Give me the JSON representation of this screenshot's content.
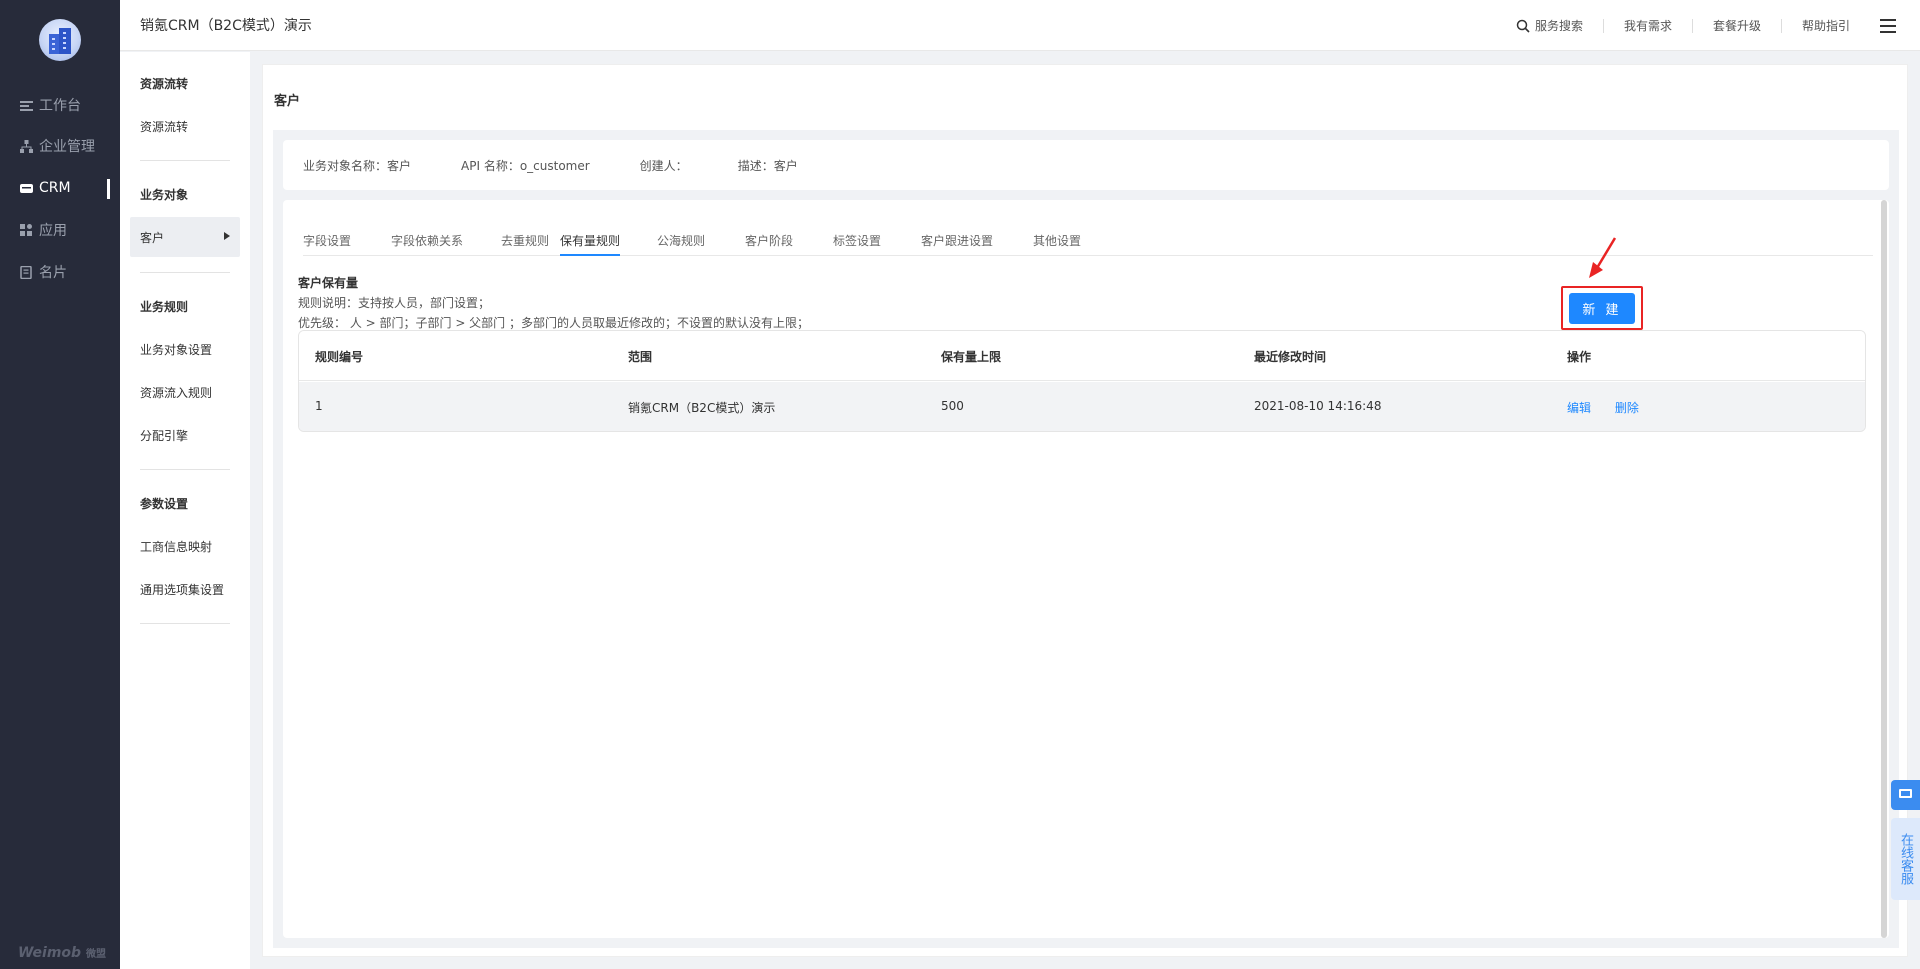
{
  "app": {
    "title": "销氪CRM（B2C模式）演示"
  },
  "leftnav": {
    "items": [
      {
        "label": "工作台",
        "icon": "list-icon",
        "active": false
      },
      {
        "label": "企业管理",
        "icon": "org-chart-icon",
        "active": false
      },
      {
        "label": "CRM",
        "icon": "crm-card-icon",
        "active": true
      },
      {
        "label": "应用",
        "icon": "apps-grid-icon",
        "active": false
      },
      {
        "label": "名片",
        "icon": "business-card-icon",
        "active": false
      }
    ],
    "brand": "Weimob",
    "brand_sub": "微盟"
  },
  "topbar": {
    "search_label": "服务搜索",
    "requirements_label": "我有需求",
    "upgrade_label": "套餐升级",
    "help_label": "帮助指引"
  },
  "sidebar": {
    "g1_title": "资源流转",
    "g1_item1": "资源流转",
    "g2_title": "业务对象",
    "g2_item1": "客户",
    "g3_title": "业务规则",
    "g3_item1": "业务对象设置",
    "g3_item2": "资源流入规则",
    "g3_item3": "分配引擎",
    "g4_title": "参数设置",
    "g4_item1": "工商信息映射",
    "g4_item2": "通用选项集设置"
  },
  "page": {
    "title": "客户",
    "info": {
      "object_name": "业务对象名称：客户",
      "api_name": "API 名称：o_customer",
      "creator": "创建人：",
      "description": "描述：客户"
    },
    "tabs": [
      "字段设置",
      "字段依赖关系",
      "去重规则",
      "保有量规则",
      "公海规则",
      "客户阶段",
      "标签设置",
      "客户跟进设置",
      "其他设置"
    ],
    "active_tab": "保有量规则",
    "rule": {
      "heading": "客户保有量",
      "line1": "规则说明：支持按人员，部门设置；",
      "line2": "优先级： 人 > 部门；子部门 > 父部门 ；多部门的人员取最近修改的；不设置的默认没有上限；"
    },
    "new_button": "新 建",
    "table": {
      "columns": [
        "规则编号",
        "范围",
        "保有量上限",
        "最近修改时间",
        "操作"
      ],
      "rows": [
        {
          "id": "1",
          "scope": "销氪CRM（B2C模式）演示",
          "limit": "500",
          "modified": "2021-08-10 14:16:48",
          "edit": "编辑",
          "delete": "删除"
        }
      ]
    }
  },
  "float": {
    "online_service": "在线客服"
  },
  "colors": {
    "accent": "#1e88ff",
    "nav_bg": "#272b3a",
    "annotation": "#e92424"
  }
}
